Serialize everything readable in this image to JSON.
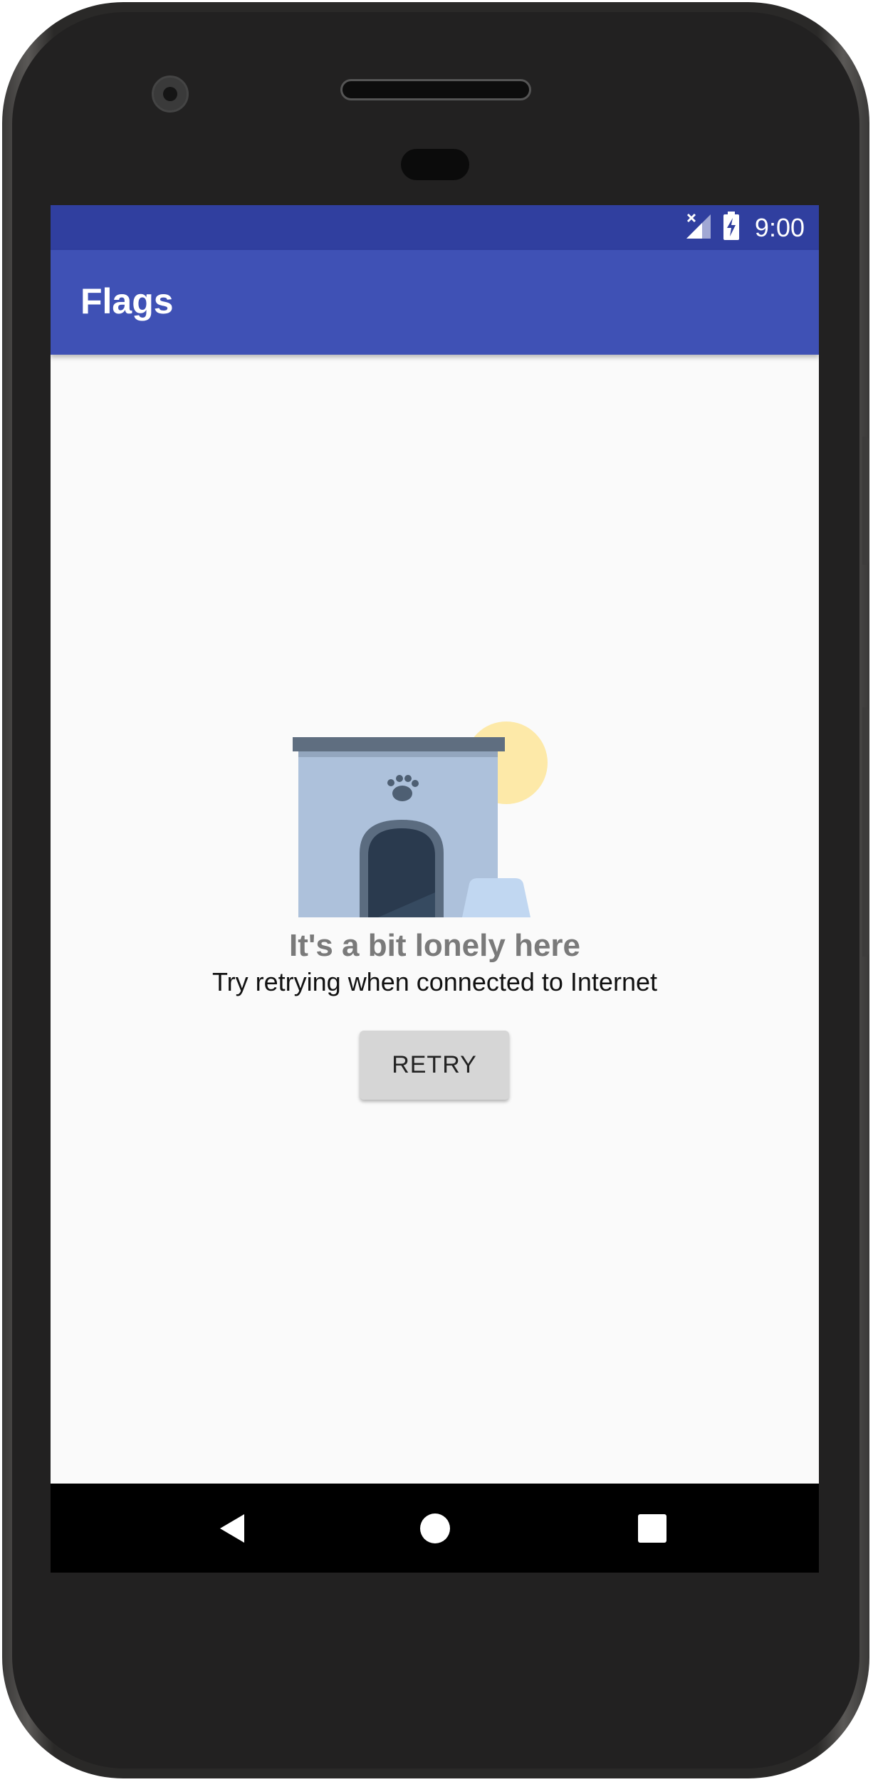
{
  "status_bar": {
    "time": "9:00",
    "icons": [
      "no-signal-icon",
      "battery-charging-icon"
    ]
  },
  "app_bar": {
    "title": "Flags"
  },
  "empty_state": {
    "illustration": "doghouse-illustration",
    "title": "It's a bit lonely here",
    "subtitle": "Try retrying when connected to Internet",
    "retry_label": "RETRY"
  },
  "nav_bar": {
    "icons": [
      "back-icon",
      "home-icon",
      "recents-icon"
    ]
  },
  "colors": {
    "status_bar": "#303f9f",
    "app_bar": "#3f51b5",
    "background": "#fafafa",
    "button": "#d6d6d6"
  }
}
